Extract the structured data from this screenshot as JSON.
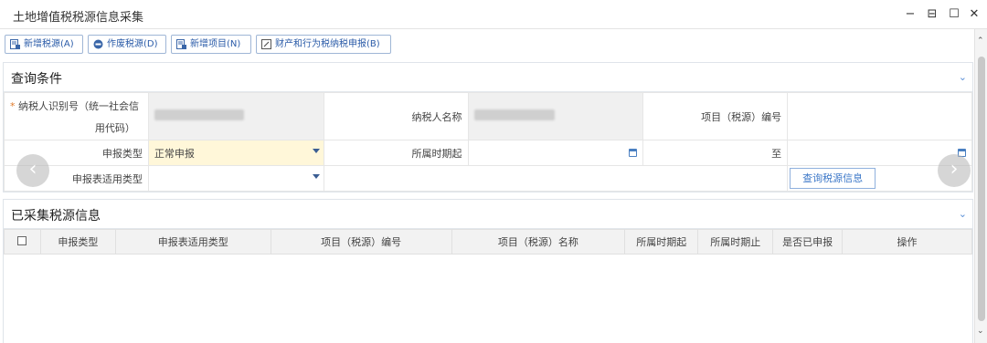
{
  "window": {
    "title": "土地增值税税源信息采集",
    "controls": [
      "−",
      "⊟",
      "☐",
      "✕"
    ]
  },
  "toolbar": {
    "add_source": "新增税源(A)",
    "void_source": "作废税源(D)",
    "add_project": "新增项目(N)",
    "property_declare": "财产和行为税纳税申报(B)"
  },
  "query": {
    "title": "查询条件",
    "taxpayer_id_label": "纳税人识别号（统一社会信用代码）",
    "taxpayer_id_label_line1": "纳税人识别号（统一社会信",
    "taxpayer_id_label_line2": "用代码）",
    "required_mark": "*",
    "taxpayer_name_label": "纳税人名称",
    "project_no_label": "项目（税源）编号",
    "declare_type_label": "申报类型",
    "declare_type_value": "正常申报",
    "period_start_label": "所属时期起",
    "to_label": "至",
    "applicable_type_label": "申报表适用类型",
    "query_button": "查询税源信息"
  },
  "collected": {
    "title": "已采集税源信息",
    "columns": [
      "申报类型",
      "申报表适用类型",
      "项目（税源）编号",
      "项目（税源）名称",
      "所属时期起",
      "所属时期止",
      "是否已申报",
      "操作"
    ]
  },
  "icons": {
    "collapse": "chevron-down-icon",
    "prev": "‹",
    "next": "›"
  }
}
